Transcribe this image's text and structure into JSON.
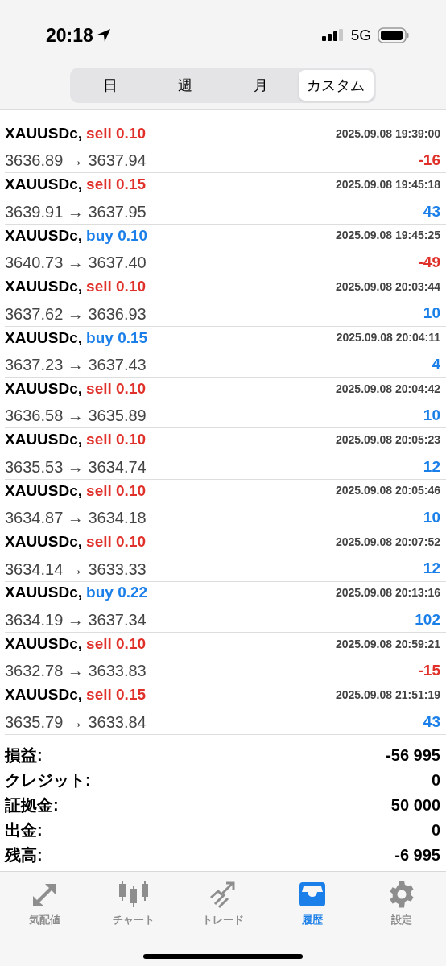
{
  "status_bar": {
    "time": "20:18",
    "network": "5G"
  },
  "period_tabs": [
    {
      "label": "日",
      "selected": false
    },
    {
      "label": "週",
      "selected": false
    },
    {
      "label": "月",
      "selected": false
    },
    {
      "label": "カスタム",
      "selected": true
    }
  ],
  "deals": [
    {
      "symbol": "XAUUSDc,",
      "buy": false,
      "volume": "sell 0.10",
      "time": "2025.09.08 19:39:00",
      "prices": "3636.89 → 3637.94",
      "profit": "-16",
      "loss": true
    },
    {
      "symbol": "XAUUSDc,",
      "buy": false,
      "volume": "sell 0.15",
      "time": "2025.09.08 19:45:18",
      "prices": "3639.91 → 3637.95",
      "profit": "43",
      "loss": false
    },
    {
      "symbol": "XAUUSDc,",
      "buy": true,
      "volume": "buy 0.10",
      "time": "2025.09.08 19:45:25",
      "prices": "3640.73 → 3637.40",
      "profit": "-49",
      "loss": true
    },
    {
      "symbol": "XAUUSDc,",
      "buy": false,
      "volume": "sell 0.10",
      "time": "2025.09.08 20:03:44",
      "prices": "3637.62 → 3636.93",
      "profit": "10",
      "loss": false
    },
    {
      "symbol": "XAUUSDc,",
      "buy": true,
      "volume": "buy 0.15",
      "time": "2025.09.08 20:04:11",
      "prices": "3637.23 → 3637.43",
      "profit": "4",
      "loss": false
    },
    {
      "symbol": "XAUUSDc,",
      "buy": false,
      "volume": "sell 0.10",
      "time": "2025.09.08 20:04:42",
      "prices": "3636.58 → 3635.89",
      "profit": "10",
      "loss": false
    },
    {
      "symbol": "XAUUSDc,",
      "buy": false,
      "volume": "sell 0.10",
      "time": "2025.09.08 20:05:23",
      "prices": "3635.53 → 3634.74",
      "profit": "12",
      "loss": false
    },
    {
      "symbol": "XAUUSDc,",
      "buy": false,
      "volume": "sell 0.10",
      "time": "2025.09.08 20:05:46",
      "prices": "3634.87 → 3634.18",
      "profit": "10",
      "loss": false
    },
    {
      "symbol": "XAUUSDc,",
      "buy": false,
      "volume": "sell 0.10",
      "time": "2025.09.08 20:07:52",
      "prices": "3634.14 → 3633.33",
      "profit": "12",
      "loss": false
    },
    {
      "symbol": "XAUUSDc,",
      "buy": true,
      "volume": "buy 0.22",
      "time": "2025.09.08 20:13:16",
      "prices": "3634.19 → 3637.34",
      "profit": "102",
      "loss": false
    },
    {
      "symbol": "XAUUSDc,",
      "buy": false,
      "volume": "sell 0.10",
      "time": "2025.09.08 20:59:21",
      "prices": "3632.78 → 3633.83",
      "profit": "-15",
      "loss": true
    },
    {
      "symbol": "XAUUSDc,",
      "buy": false,
      "volume": "sell 0.15",
      "time": "2025.09.08 21:51:19",
      "prices": "3635.79 → 3633.84",
      "profit": "43",
      "loss": false
    }
  ],
  "summary": [
    {
      "label": "損益:",
      "value": "-56 995"
    },
    {
      "label": "クレジット:",
      "value": "0"
    },
    {
      "label": "証拠金:",
      "value": "50 000"
    },
    {
      "label": "出金:",
      "value": "0"
    },
    {
      "label": "残高:",
      "value": "-6 995"
    }
  ],
  "bottom_tabs": [
    {
      "label": "気配値",
      "kind": "quotes",
      "selected": false
    },
    {
      "label": "チャート",
      "kind": "chart",
      "selected": false
    },
    {
      "label": "トレード",
      "kind": "trade",
      "selected": false
    },
    {
      "label": "履歴",
      "kind": "history",
      "selected": true
    },
    {
      "label": "設定",
      "kind": "settings",
      "selected": false
    }
  ]
}
